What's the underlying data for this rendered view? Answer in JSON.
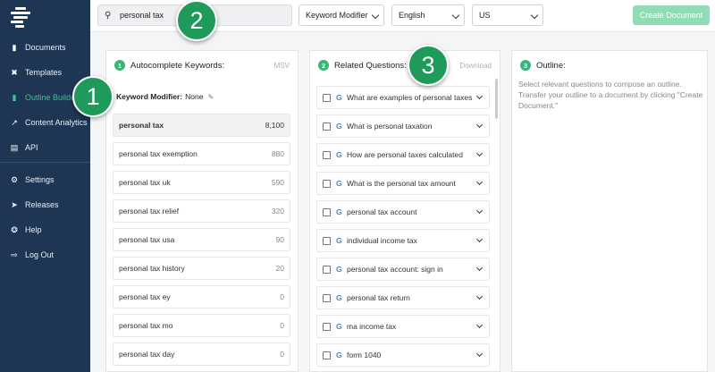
{
  "sidebar": {
    "items": [
      {
        "label": "Documents",
        "icon": "document-icon",
        "active": false
      },
      {
        "label": "Templates",
        "icon": "tools-icon",
        "active": false
      },
      {
        "label": "Outline Builder",
        "icon": "outline-icon",
        "active": true
      },
      {
        "label": "Content Analytics",
        "icon": "analytics-icon",
        "active": false
      },
      {
        "label": "API",
        "icon": "api-icon",
        "active": false
      }
    ],
    "bottom_items": [
      {
        "label": "Settings",
        "icon": "gear-icon"
      },
      {
        "label": "Releases",
        "icon": "rocket-icon"
      },
      {
        "label": "Help",
        "icon": "help-icon"
      },
      {
        "label": "Log Out",
        "icon": "logout-icon"
      }
    ]
  },
  "topbar": {
    "search_value": "personal tax",
    "modifier_select": "Keyword Modifier",
    "language_select": "English",
    "country_select": "US",
    "create_button": "Create Document"
  },
  "autocomplete": {
    "number": "1",
    "title": "Autocomplete Keywords:",
    "msv_label": "MSV",
    "modifier_label": "Keyword Modifier:",
    "modifier_value": "None",
    "keywords": [
      {
        "text": "personal tax",
        "volume": "8,100"
      },
      {
        "text": "personal tax exemption",
        "volume": "880"
      },
      {
        "text": "personal tax uk",
        "volume": "590"
      },
      {
        "text": "personal tax relief",
        "volume": "320"
      },
      {
        "text": "personal tax usa",
        "volume": "90"
      },
      {
        "text": "personal tax history",
        "volume": "20"
      },
      {
        "text": "personal tax ey",
        "volume": "0"
      },
      {
        "text": "personal tax mo",
        "volume": "0"
      },
      {
        "text": "personal tax day",
        "volume": "0"
      }
    ]
  },
  "questions": {
    "number": "2",
    "title": "Related Questions:",
    "download_label": "Download",
    "items": [
      "What are examples of personal taxes",
      "What is personal taxation",
      "How are personal taxes calculated",
      "What is the personal tax amount",
      "personal tax account",
      "individual income tax",
      "personal tax account: sign in",
      "personal tax return",
      "ma income tax",
      "form 1040"
    ]
  },
  "outline": {
    "number": "3",
    "title": "Outline:",
    "help_text": "Select relevant questions to compose an outline. Transfer your outline to a document by clicking \"Create Document.\""
  },
  "callouts": [
    "1",
    "2",
    "3"
  ],
  "colors": {
    "sidebar": "#1e3553",
    "accent": "#39c78a",
    "callout": "#1f9a5a",
    "create_button": "#8fdcb6"
  }
}
